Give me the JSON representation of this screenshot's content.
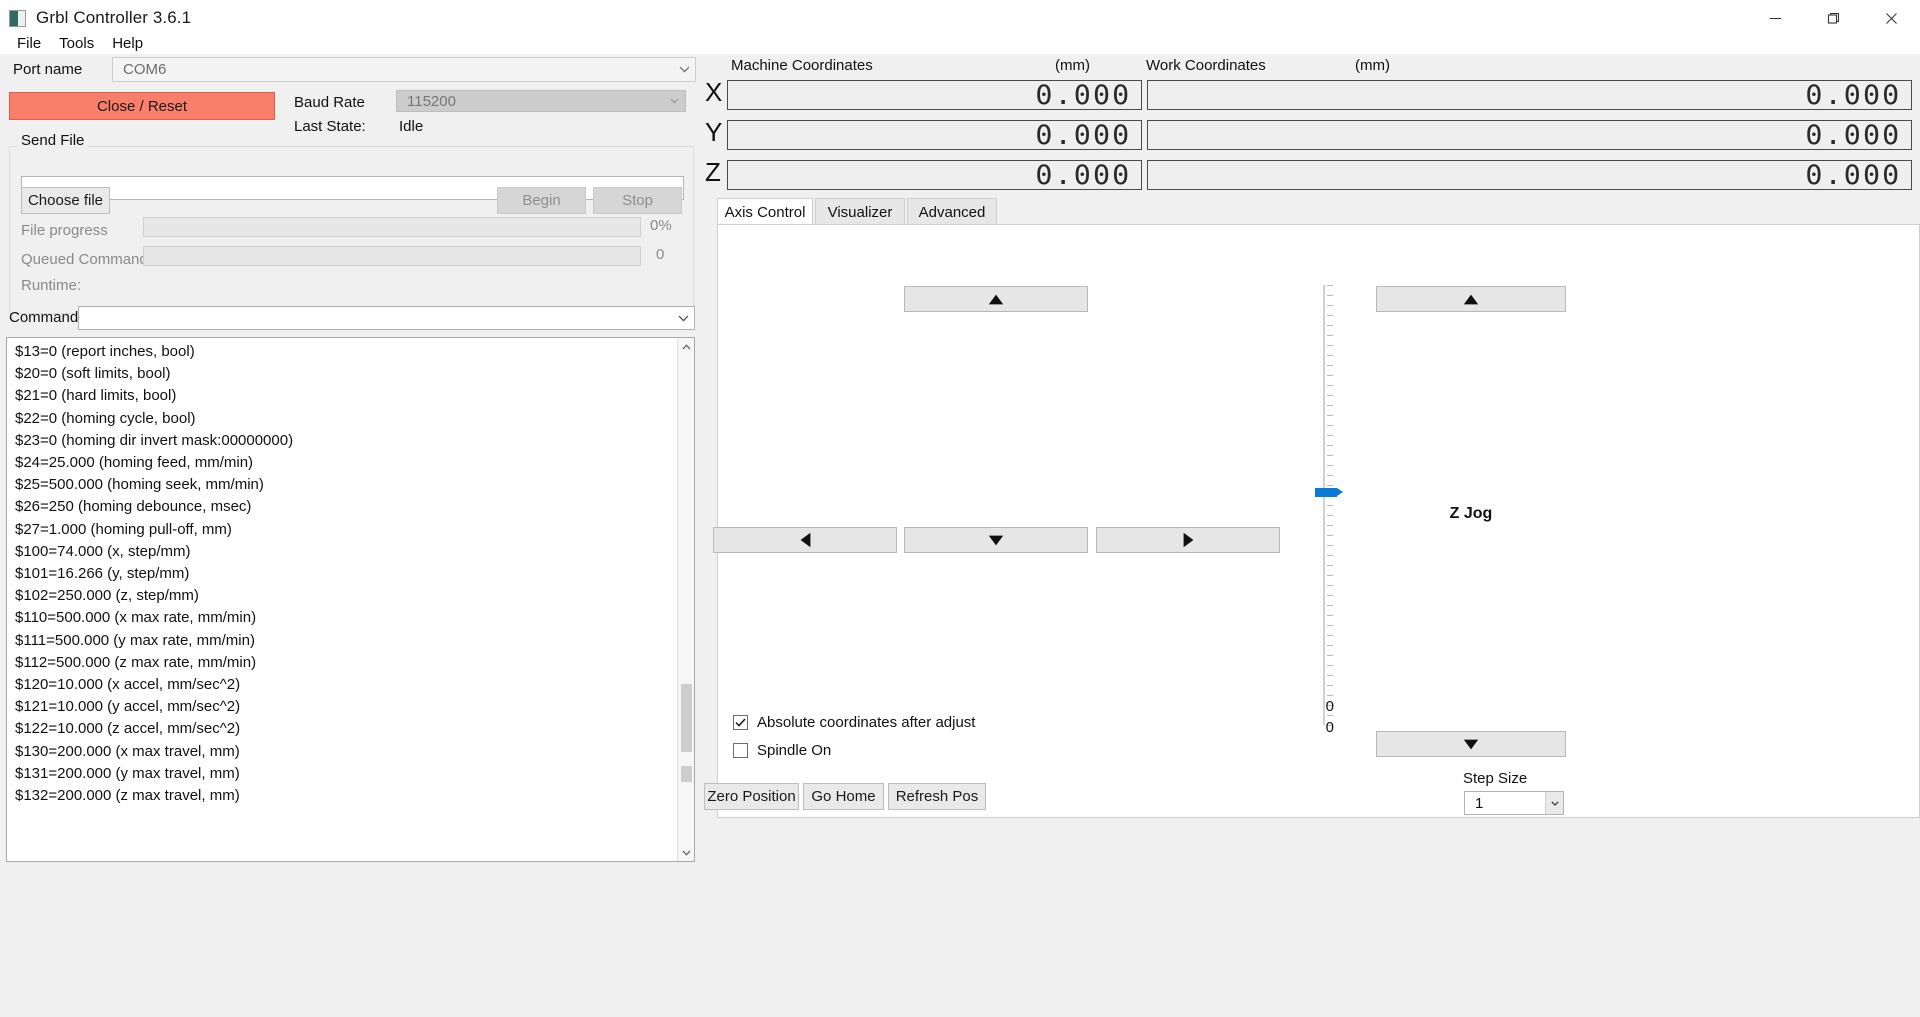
{
  "window": {
    "title": "Grbl Controller 3.6.1",
    "icon": "app-icon",
    "minimize": "minimize-icon",
    "maximize": "maximize-icon",
    "close": "close-icon"
  },
  "menu": {
    "items": [
      {
        "label": "File"
      },
      {
        "label": "Tools"
      },
      {
        "label": "Help"
      }
    ]
  },
  "connection": {
    "port_label": "Port name",
    "port_value": "COM6",
    "close_reset_label": "Close / Reset",
    "close_reset_color": "#fa7f6a",
    "baud_label": "Baud Rate",
    "baud_value": "115200",
    "last_state_label": "Last State:",
    "last_state_value": "Idle"
  },
  "send_file": {
    "group_title": "Send File",
    "file_path_value": "",
    "choose_file_label": "Choose file",
    "begin_label": "Begin",
    "stop_label": "Stop",
    "file_progress_label": "File progress",
    "file_progress_value": "0%",
    "queued_label": "Queued Commands",
    "queued_value": "0",
    "runtime_label": "Runtime:"
  },
  "command": {
    "label": "Command",
    "value": ""
  },
  "console": {
    "lines": [
      "$13=0 (report inches, bool)",
      "$20=0 (soft limits, bool)",
      "$21=0 (hard limits, bool)",
      "$22=0 (homing cycle, bool)",
      "$23=0 (homing dir invert mask:00000000)",
      "$24=25.000 (homing feed, mm/min)",
      "$25=500.000 (homing seek, mm/min)",
      "$26=250 (homing debounce, msec)",
      "$27=1.000 (homing pull-off, mm)",
      "$100=74.000 (x, step/mm)",
      "$101=16.266 (y, step/mm)",
      "$102=250.000 (z, step/mm)",
      "$110=500.000 (x max rate, mm/min)",
      "$111=500.000 (y max rate, mm/min)",
      "$112=500.000 (z max rate, mm/min)",
      "$120=10.000 (x accel, mm/sec^2)",
      "$121=10.000 (y accel, mm/sec^2)",
      "$122=10.000 (z accel, mm/sec^2)",
      "$130=200.000 (x max travel, mm)",
      "$131=200.000 (y max travel, mm)",
      "$132=200.000 (z max travel, mm)"
    ]
  },
  "coordinates": {
    "machine_header": "Machine Coordinates",
    "machine_unit": "(mm)",
    "work_header": "Work Coordinates",
    "work_unit": "(mm)",
    "axes": [
      {
        "name": "X",
        "machine": "0.000",
        "work": "0.000"
      },
      {
        "name": "Y",
        "machine": "0.000",
        "work": "0.000"
      },
      {
        "name": "Z",
        "machine": "0.000",
        "work": "0.000"
      }
    ]
  },
  "tabs": [
    {
      "label": "Axis Control",
      "active": true
    },
    {
      "label": "Visualizer",
      "active": false
    },
    {
      "label": "Advanced",
      "active": false
    }
  ],
  "axis_control": {
    "jog_up": "up-arrow",
    "jog_down": "down-arrow",
    "jog_left": "left-arrow",
    "jog_right": "right-arrow",
    "feed_slider_value_top": "0",
    "feed_slider_value_bottom": "0",
    "z_jog_title": "Z Jog",
    "z_up": "up-arrow",
    "z_down": "down-arrow",
    "step_size_label": "Step Size",
    "step_size_value": "1",
    "absolute_checkbox_label": "Absolute coordinates after adjust",
    "absolute_checked": true,
    "spindle_checkbox_label": "Spindle On",
    "spindle_checked": false
  },
  "bottom_bar": {
    "zero_position": "Zero Position",
    "go_home": "Go Home",
    "refresh_pos": "Refresh Pos"
  }
}
